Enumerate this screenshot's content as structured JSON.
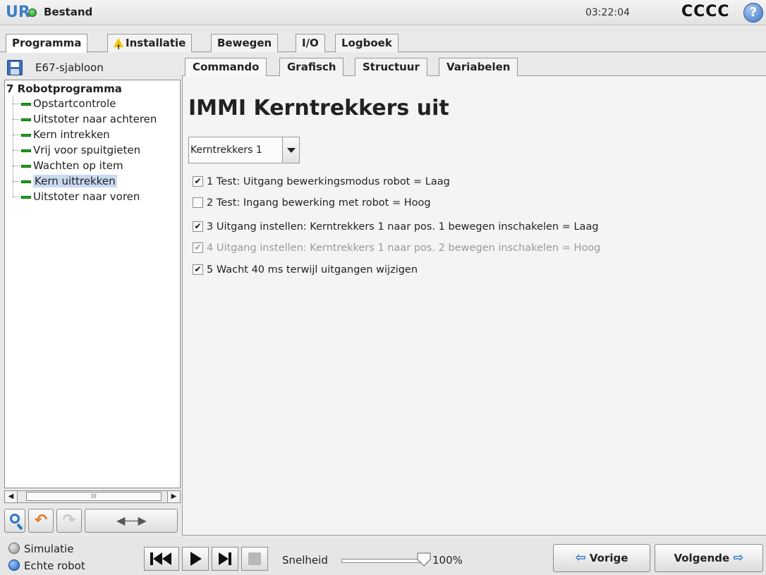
{
  "topbar": {
    "logo": "UR",
    "menu_file": "Bestand",
    "clock": "03:22:04",
    "robot_name": "CCCC",
    "help": "?"
  },
  "main_tabs": [
    {
      "label": "Programma",
      "active": true
    },
    {
      "label": "Installatie",
      "active": false,
      "warning": true
    },
    {
      "label": "Bewegen",
      "active": false
    },
    {
      "label": "I/O",
      "active": false
    },
    {
      "label": "Logboek",
      "active": false
    }
  ],
  "left_panel": {
    "file_name": "E67-sjabloon",
    "tree_root": "Robotprogramma",
    "tree_root_marker": "7",
    "items": [
      {
        "label": "Opstartcontrole",
        "selected": false
      },
      {
        "label": "Uitstoter naar achteren",
        "selected": false
      },
      {
        "label": "Kern intrekken",
        "selected": false
      },
      {
        "label": "Vrij voor spuitgieten",
        "selected": false
      },
      {
        "label": "Wachten op item",
        "selected": false
      },
      {
        "label": "Kern uittrekken",
        "selected": true
      },
      {
        "label": "Uitstoter naar voren",
        "selected": false
      }
    ],
    "scroll_thumb": "III"
  },
  "content_tabs": [
    {
      "label": "Commando",
      "active": true
    },
    {
      "label": "Grafisch",
      "active": false
    },
    {
      "label": "Structuur",
      "active": false
    },
    {
      "label": "Variabelen",
      "active": false
    }
  ],
  "content": {
    "title": "IMMI Kerntrekkers uit",
    "dropdown_value": "Kerntrekkers 1",
    "checks": [
      {
        "label": "1 Test: Uitgang bewerkingsmodus robot = Laag",
        "checked": true,
        "disabled": false
      },
      {
        "label": "2 Test: Ingang bewerking met robot = Hoog",
        "checked": false,
        "disabled": false
      },
      {
        "label": "3 Uitgang instellen: Kerntrekkers 1 naar pos. 1 bewegen inschakelen = Laag",
        "checked": true,
        "disabled": false
      },
      {
        "label": "4 Uitgang instellen: Kerntrekkers 1 naar pos. 2 bewegen inschakelen = Hoog",
        "checked": true,
        "disabled": true
      },
      {
        "label": "5 Wacht 40 ms terwijl uitgangen wijzigen",
        "checked": true,
        "disabled": false
      }
    ]
  },
  "bottombar": {
    "simulation_label": "Simulatie",
    "real_robot_label": "Echte robot",
    "speed_label": "Snelheid",
    "speed_value": "100%",
    "speed_fraction": 1.0,
    "prev_label": "Vorige",
    "next_label": "Volgende"
  },
  "colors": {
    "accent_blue": "#2a76c8",
    "status_green": "#1ea81e",
    "selection": "#c9d9f1",
    "warning_yellow": "#f2c200"
  }
}
